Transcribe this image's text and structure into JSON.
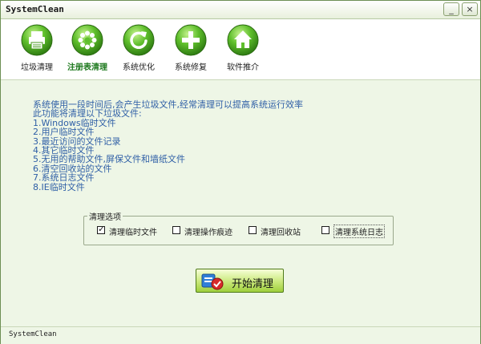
{
  "window": {
    "title": "SystemClean",
    "minimize": "_",
    "close": "×"
  },
  "toolbar": {
    "items": [
      {
        "label": "垃圾清理",
        "icon": "printer-icon",
        "active": false
      },
      {
        "label": "注册表清理",
        "icon": "gear-icon",
        "active": true
      },
      {
        "label": "系统优化",
        "icon": "refresh-icon",
        "active": false
      },
      {
        "label": "系统修复",
        "icon": "plus-icon",
        "active": false
      },
      {
        "label": "软件推介",
        "icon": "home-icon",
        "active": false
      }
    ]
  },
  "description": {
    "lines": [
      "系统使用一段时间后,会产生垃圾文件,经常清理可以提高系统运行效率",
      "此功能将清理以下垃圾文件:",
      "1.Windows临时文件",
      "2.用户临时文件",
      "3.最近访问的文件记录",
      "4.其它临时文件",
      "5.无用的帮助文件,屏保文件和墙纸文件",
      "6.清空回收站的文件",
      "7.系统日志文件",
      "8.IE临时文件"
    ]
  },
  "options": {
    "title": "清理选项",
    "items": [
      {
        "label": "清理临时文件",
        "checked": true
      },
      {
        "label": "清理操作痕迹",
        "checked": false
      },
      {
        "label": "清理回收站",
        "checked": false
      },
      {
        "label": "清理系统日志",
        "checked": false
      }
    ]
  },
  "start_button": {
    "label": "开始清理"
  },
  "status": {
    "text": "SystemClean"
  },
  "colors": {
    "accent": "#4faf2a",
    "text_blue": "#2f5fa6",
    "background": "#eef6e6"
  }
}
